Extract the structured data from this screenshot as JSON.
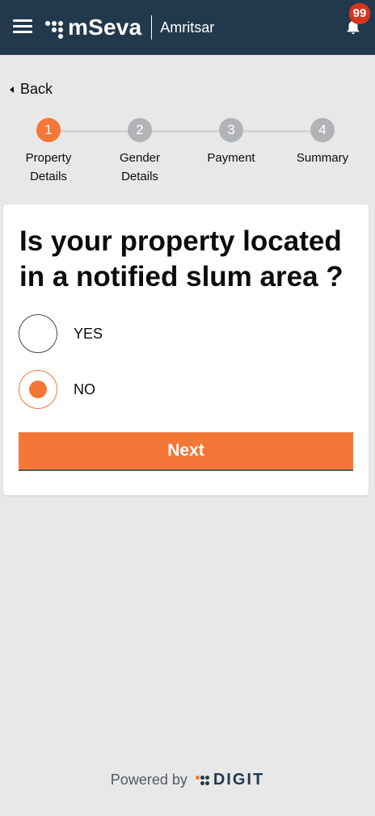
{
  "header": {
    "brand": "mSeva",
    "city": "Amritsar",
    "notification_count": "99"
  },
  "nav": {
    "back_label": "Back"
  },
  "stepper": {
    "steps": [
      {
        "number": "1",
        "label_line1": "Property",
        "label_line2": "Details",
        "active": true
      },
      {
        "number": "2",
        "label_line1": "Gender",
        "label_line2": "Details",
        "active": false
      },
      {
        "number": "3",
        "label_line1": "Payment",
        "label_line2": "",
        "active": false
      },
      {
        "number": "4",
        "label_line1": "Summary",
        "label_line2": "",
        "active": false
      }
    ]
  },
  "form": {
    "question": "Is your property located in a notified slum area ?",
    "options": [
      {
        "label": "YES",
        "selected": false
      },
      {
        "label": "NO",
        "selected": true
      }
    ],
    "next_label": "Next"
  },
  "footer": {
    "powered_by": "Powered by",
    "brand": "DIGIT"
  },
  "colors": {
    "header_bg": "#22394d",
    "accent": "#f47738",
    "badge": "#d4351c",
    "inactive_step": "#b1b4b6"
  }
}
